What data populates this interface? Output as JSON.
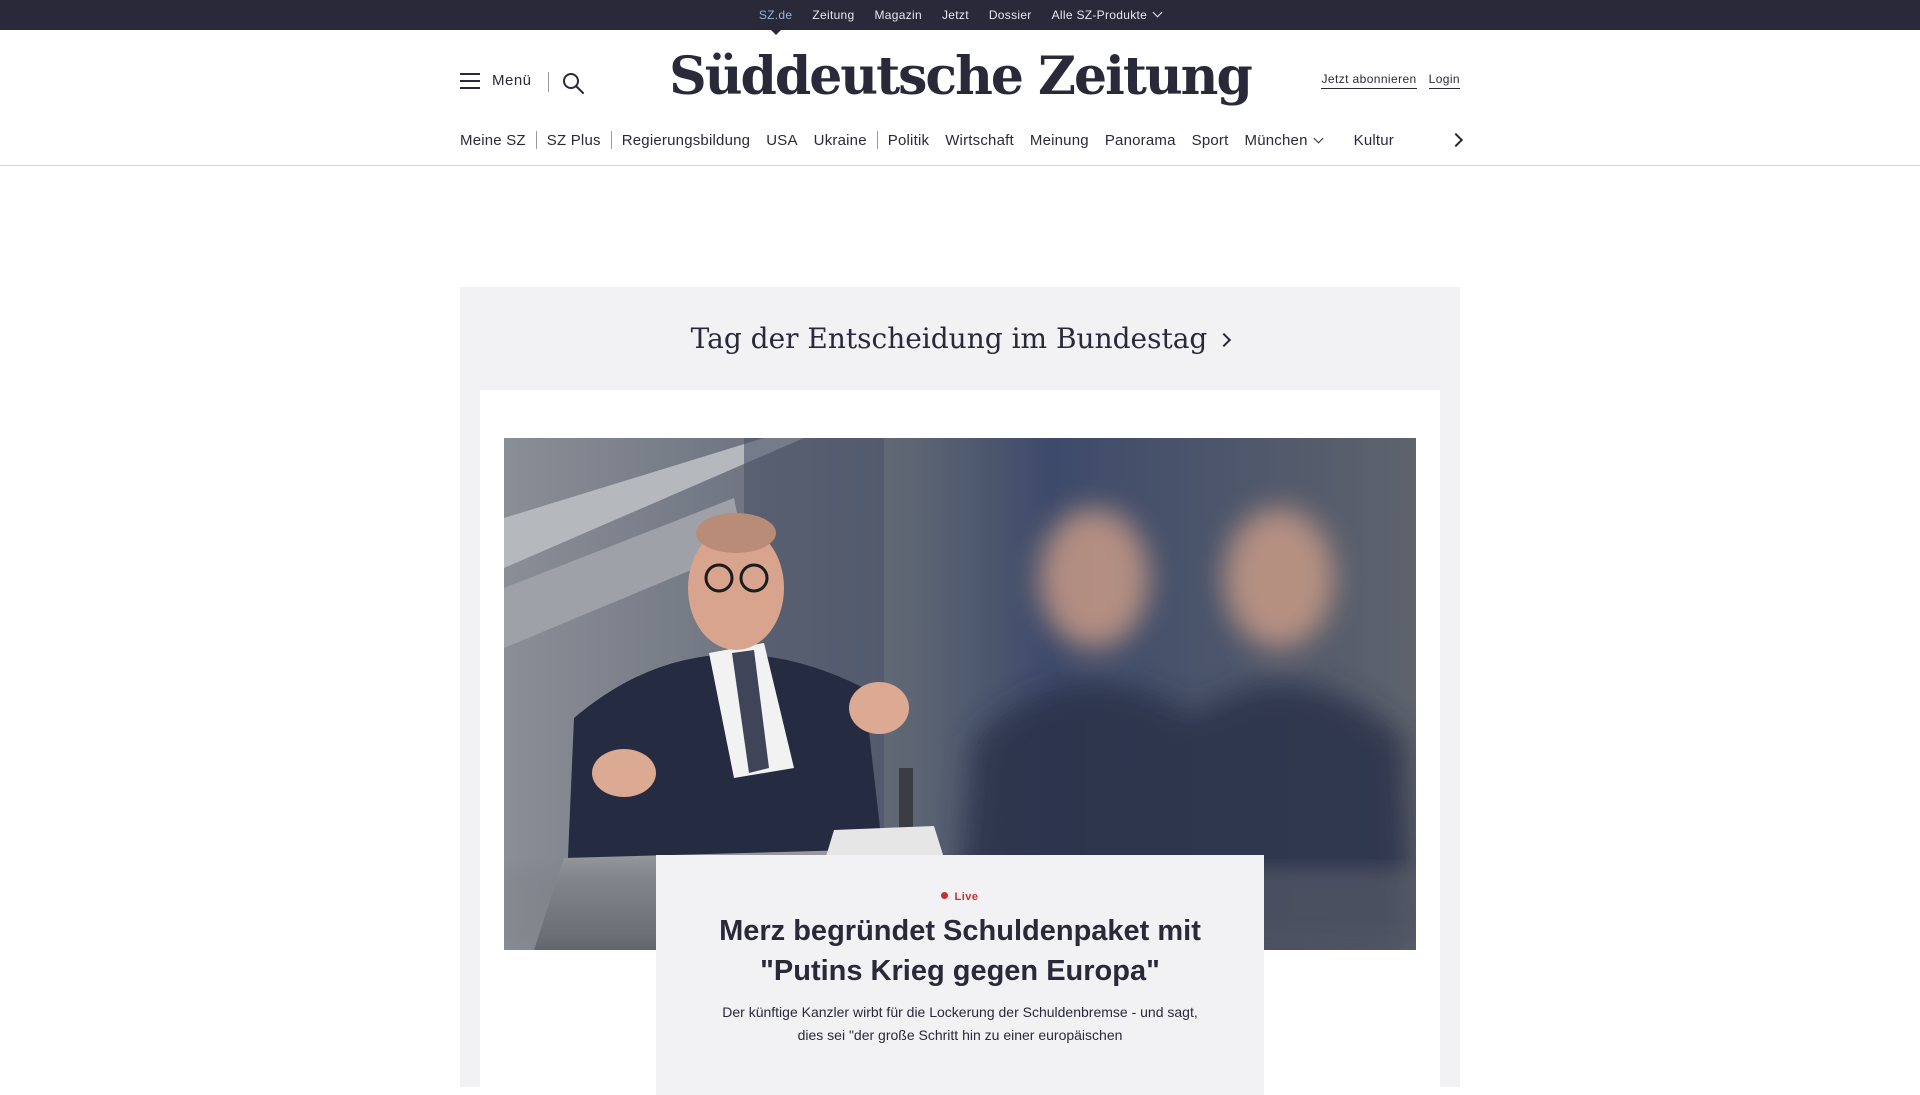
{
  "topbar": {
    "items": [
      "SZ.de",
      "Zeitung",
      "Magazin",
      "Jetzt",
      "Dossier",
      "Alle SZ-Produkte"
    ],
    "active_index": 0
  },
  "header": {
    "menu_label": "Menü",
    "logo_text": "Süddeutsche Zeitung",
    "subscribe_label": "Jetzt abonnieren",
    "login_label": "Login"
  },
  "nav": {
    "items": [
      "Meine SZ",
      "SZ Plus",
      "Regierungsbildung",
      "USA",
      "Ukraine",
      "Politik",
      "Wirtschaft",
      "Meinung",
      "Panorama",
      "Sport",
      "München",
      "Kultur"
    ]
  },
  "section": {
    "title": "Tag der Entscheidung im Bundestag"
  },
  "article": {
    "live_label": "Live",
    "headline": "Merz begründet Schuldenpaket mit \"Putins Krieg gegen Europa\"",
    "teaser": "Der künftige Kanzler wirbt für die Lockerung der Schuldenbremse - und sagt, dies sei \"der große Schritt hin zu einer europäischen"
  },
  "colors": {
    "topbar_bg": "#29293a",
    "active_link": "#8fb7d9",
    "live_red": "#c8302e",
    "panel_bg": "#f2f2f4"
  }
}
